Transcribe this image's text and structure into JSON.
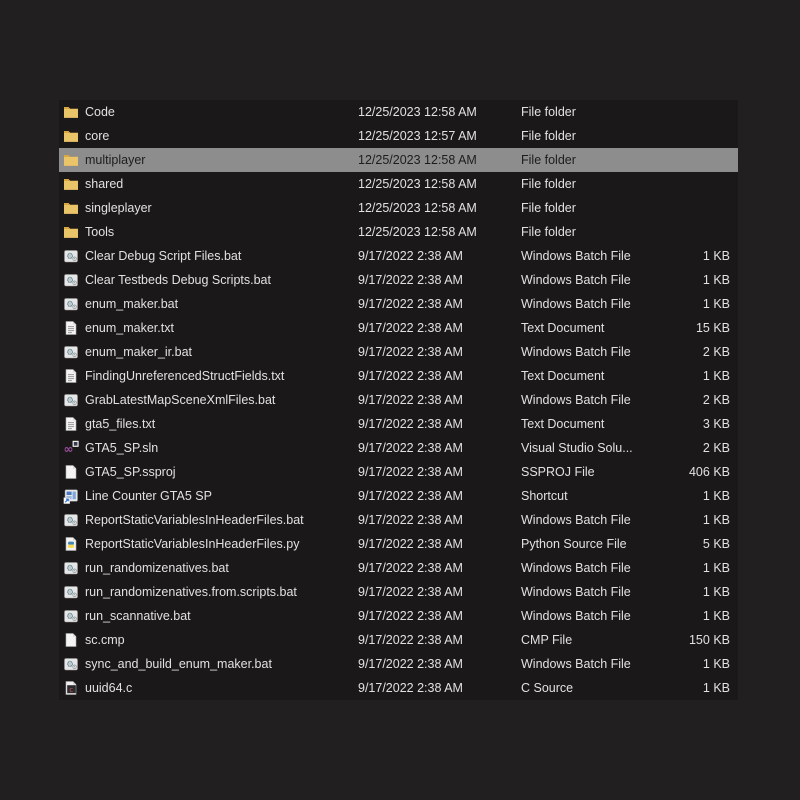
{
  "window": {
    "background_color": "#211f20",
    "list_background_color": "#1a1819",
    "selection_color": "#8d8d8d",
    "text_color": "#e2e0e0"
  },
  "file_list": {
    "columns": [
      "name",
      "date_modified",
      "type",
      "size"
    ],
    "rows": [
      {
        "name": "Code",
        "date": "12/25/2023 12:58 AM",
        "type": "File folder",
        "size": "",
        "icon": "folder-icon",
        "selected": false
      },
      {
        "name": "core",
        "date": "12/25/2023 12:57 AM",
        "type": "File folder",
        "size": "",
        "icon": "folder-icon",
        "selected": false
      },
      {
        "name": "multiplayer",
        "date": "12/25/2023 12:58 AM",
        "type": "File folder",
        "size": "",
        "icon": "folder-icon",
        "selected": true
      },
      {
        "name": "shared",
        "date": "12/25/2023 12:58 AM",
        "type": "File folder",
        "size": "",
        "icon": "folder-icon",
        "selected": false
      },
      {
        "name": "singleplayer",
        "date": "12/25/2023 12:58 AM",
        "type": "File folder",
        "size": "",
        "icon": "folder-icon",
        "selected": false
      },
      {
        "name": "Tools",
        "date": "12/25/2023 12:58 AM",
        "type": "File folder",
        "size": "",
        "icon": "folder-icon",
        "selected": false
      },
      {
        "name": "Clear Debug Script Files.bat",
        "date": "9/17/2022 2:38 AM",
        "type": "Windows Batch File",
        "size": "1 KB",
        "icon": "batch-file-icon",
        "selected": false
      },
      {
        "name": "Clear Testbeds Debug Scripts.bat",
        "date": "9/17/2022 2:38 AM",
        "type": "Windows Batch File",
        "size": "1 KB",
        "icon": "batch-file-icon",
        "selected": false
      },
      {
        "name": "enum_maker.bat",
        "date": "9/17/2022 2:38 AM",
        "type": "Windows Batch File",
        "size": "1 KB",
        "icon": "batch-file-icon",
        "selected": false
      },
      {
        "name": "enum_maker.txt",
        "date": "9/17/2022 2:38 AM",
        "type": "Text Document",
        "size": "15 KB",
        "icon": "text-document-icon",
        "selected": false
      },
      {
        "name": "enum_maker_ir.bat",
        "date": "9/17/2022 2:38 AM",
        "type": "Windows Batch File",
        "size": "2 KB",
        "icon": "batch-file-icon",
        "selected": false
      },
      {
        "name": "FindingUnreferencedStructFields.txt",
        "date": "9/17/2022 2:38 AM",
        "type": "Text Document",
        "size": "1 KB",
        "icon": "text-document-icon",
        "selected": false
      },
      {
        "name": "GrabLatestMapSceneXmlFiles.bat",
        "date": "9/17/2022 2:38 AM",
        "type": "Windows Batch File",
        "size": "2 KB",
        "icon": "batch-file-icon",
        "selected": false
      },
      {
        "name": "gta5_files.txt",
        "date": "9/17/2022 2:38 AM",
        "type": "Text Document",
        "size": "3 KB",
        "icon": "text-document-icon",
        "selected": false
      },
      {
        "name": "GTA5_SP.sln",
        "date": "9/17/2022 2:38 AM",
        "type": "Visual Studio Solu...",
        "size": "2 KB",
        "icon": "vs-solution-icon",
        "selected": false
      },
      {
        "name": "GTA5_SP.ssproj",
        "date": "9/17/2022 2:38 AM",
        "type": "SSPROJ File",
        "size": "406 KB",
        "icon": "document-icon",
        "selected": false
      },
      {
        "name": "Line Counter GTA5 SP",
        "date": "9/17/2022 2:38 AM",
        "type": "Shortcut",
        "size": "1 KB",
        "icon": "shortcut-icon",
        "selected": false
      },
      {
        "name": "ReportStaticVariablesInHeaderFiles.bat",
        "date": "9/17/2022 2:38 AM",
        "type": "Windows Batch File",
        "size": "1 KB",
        "icon": "batch-file-icon",
        "selected": false
      },
      {
        "name": "ReportStaticVariablesInHeaderFiles.py",
        "date": "9/17/2022 2:38 AM",
        "type": "Python Source File",
        "size": "5 KB",
        "icon": "python-icon",
        "selected": false
      },
      {
        "name": "run_randomizenatives.bat",
        "date": "9/17/2022 2:38 AM",
        "type": "Windows Batch File",
        "size": "1 KB",
        "icon": "batch-file-icon",
        "selected": false
      },
      {
        "name": "run_randomizenatives.from.scripts.bat",
        "date": "9/17/2022 2:38 AM",
        "type": "Windows Batch File",
        "size": "1 KB",
        "icon": "batch-file-icon",
        "selected": false
      },
      {
        "name": "run_scannative.bat",
        "date": "9/17/2022 2:38 AM",
        "type": "Windows Batch File",
        "size": "1 KB",
        "icon": "batch-file-icon",
        "selected": false
      },
      {
        "name": "sc.cmp",
        "date": "9/17/2022 2:38 AM",
        "type": "CMP File",
        "size": "150 KB",
        "icon": "document-icon",
        "selected": false
      },
      {
        "name": "sync_and_build_enum_maker.bat",
        "date": "9/17/2022 2:38 AM",
        "type": "Windows Batch File",
        "size": "1 KB",
        "icon": "batch-file-icon",
        "selected": false
      },
      {
        "name": "uuid64.c",
        "date": "9/17/2022 2:38 AM",
        "type": "C Source",
        "size": "1 KB",
        "icon": "c-source-icon",
        "selected": false
      }
    ]
  }
}
